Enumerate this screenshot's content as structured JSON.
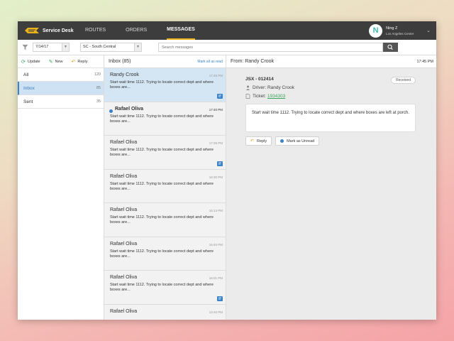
{
  "topbar": {
    "app_title": "Service Desk",
    "nav": [
      "ROUTES",
      "ORDERS",
      "MESSAGES"
    ],
    "active_nav": "MESSAGES",
    "user": {
      "initial": "N",
      "name": "Ning Z",
      "location": "Los Angeles Center"
    }
  },
  "filters": {
    "date": "7/14/17",
    "region": "SC - South Central",
    "search_placeholder": "Search messages"
  },
  "folders": {
    "toolbar": {
      "update": "Update",
      "new": "New",
      "reply": "Reply"
    },
    "items": [
      {
        "label": "All",
        "count": "120"
      },
      {
        "label": "Inbox",
        "count": "85"
      },
      {
        "label": "Sent",
        "count": "35"
      }
    ]
  },
  "inbox": {
    "title": "Inbox (85)",
    "mark_all": "Mark all as read",
    "messages": [
      {
        "name": "Randy Crook",
        "time": "17:45 PM",
        "preview": "Start wait time 1112. Trying to locate correct dept and where boxes are...",
        "attachment": true
      },
      {
        "name": "Rafael Oliva",
        "time": "17:40 PM",
        "preview": "Start wait time 1112. Trying to locate correct dept and where boxes are...",
        "attachment": false
      },
      {
        "name": "Rafael Oliva",
        "time": "17:35 PM",
        "preview": "Start wait time 1112. Trying to locate correct dept and where boxes are...",
        "attachment": true
      },
      {
        "name": "Rafael Oliva",
        "time": "16:30 PM",
        "preview": "Start wait time 1112. Trying to locate correct dept and where boxes are...",
        "attachment": false
      },
      {
        "name": "Rafael Oliva",
        "time": "16:13 PM",
        "preview": "Start wait time 1112. Trying to locate correct dept and where boxes are...",
        "attachment": false
      },
      {
        "name": "Rafael Oliva",
        "time": "16:40 PM",
        "preview": "Start wait time 1112. Trying to locate correct dept and where boxes are...",
        "attachment": false
      },
      {
        "name": "Rafael Oliva",
        "time": "16:01 PM",
        "preview": "Start wait time 1112. Trying to locate correct dept and where boxes are...",
        "attachment": true
      },
      {
        "name": "Rafael Oliva",
        "time": "13:40 PM",
        "preview": "",
        "attachment": false
      }
    ]
  },
  "detail": {
    "from": "From: Randy Crook",
    "time": "17:45 PM",
    "jsx": "JSX - 012414",
    "status": "Received",
    "driver": "Driver: Randy Crook",
    "ticket_label": "Ticket:",
    "ticket_number": "1934303",
    "body": "Start wait time 1112. Trying to locate correct dept and where boxes are left at porch.",
    "reply": "Reply",
    "mark_unread": "Mark as Unread"
  },
  "colors": {
    "accent_blue": "#3a83c8",
    "nav_active": "#e8b21a",
    "link_green": "#3aa55a",
    "topbar": "#3d3d3d"
  }
}
